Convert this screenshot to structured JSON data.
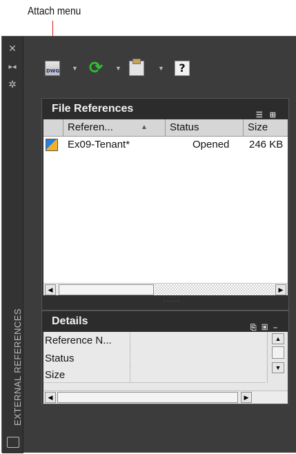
{
  "callout": {
    "label": "Attach menu"
  },
  "palette": {
    "title": "EXTERNAL REFERENCES"
  },
  "file_references": {
    "title": "File References",
    "columns": [
      "Referen...",
      "Status",
      "Size"
    ],
    "rows": [
      {
        "name": "Ex09-Tenant*",
        "status": "Opened",
        "size": "246 KB"
      }
    ]
  },
  "details": {
    "title": "Details",
    "properties": [
      "Reference N...",
      "Status",
      "Size"
    ]
  },
  "icons": {
    "attach": "attach-dwg-icon",
    "refresh": "refresh-icon",
    "paste": "change-path-icon",
    "help": "help-icon",
    "attach_tag": "DWG"
  }
}
